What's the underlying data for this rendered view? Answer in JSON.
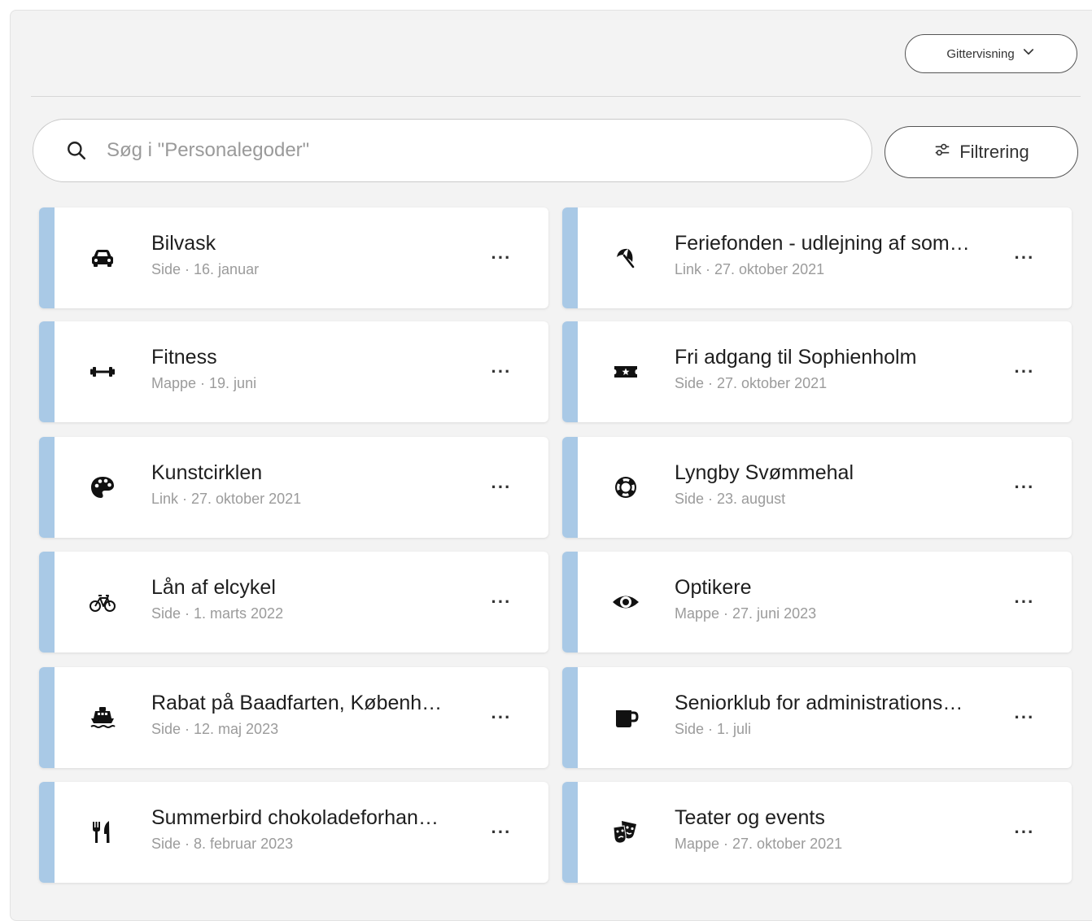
{
  "toolbar": {
    "view_toggle_label": "Gittervisning",
    "filter_label": "Filtrering"
  },
  "search": {
    "placeholder": "Søg i \"Personalegoder\"",
    "value": ""
  },
  "more_label": "···",
  "colors": {
    "accent": "#a9c9e6",
    "panel_bg": "#f3f3f3"
  },
  "items": [
    {
      "title": "Bilvask",
      "meta": "Side · 16. januar",
      "icon": "car-icon"
    },
    {
      "title": "Feriefonden - udlejning af som…",
      "meta": "Link · 27. oktober 2021",
      "icon": "beach-umbrella-icon"
    },
    {
      "title": "Fitness",
      "meta": "Mappe · 19. juni",
      "icon": "dumbbell-icon"
    },
    {
      "title": "Fri adgang til Sophienholm",
      "meta": "Side · 27. oktober 2021",
      "icon": "ticket-icon"
    },
    {
      "title": "Kunstcirklen",
      "meta": "Link · 27. oktober 2021",
      "icon": "palette-icon"
    },
    {
      "title": "Lyngby Svømmehal",
      "meta": "Side · 23. august",
      "icon": "life-ring-icon"
    },
    {
      "title": "Lån af elcykel",
      "meta": "Side · 1. marts 2022",
      "icon": "bicycle-icon"
    },
    {
      "title": "Optikere",
      "meta": "Mappe · 27. juni 2023",
      "icon": "eye-icon"
    },
    {
      "title": "Rabat på Baadfarten, Københ…",
      "meta": "Side · 12. maj 2023",
      "icon": "ferry-icon"
    },
    {
      "title": "Seniorklub for administrations…",
      "meta": "Side · 1. juli",
      "icon": "mug-icon"
    },
    {
      "title": "Summerbird chokoladeforhan…",
      "meta": "Side · 8. februar 2023",
      "icon": "utensils-icon"
    },
    {
      "title": "Teater og events",
      "meta": "Mappe · 27. oktober 2021",
      "icon": "theater-masks-icon"
    }
  ]
}
